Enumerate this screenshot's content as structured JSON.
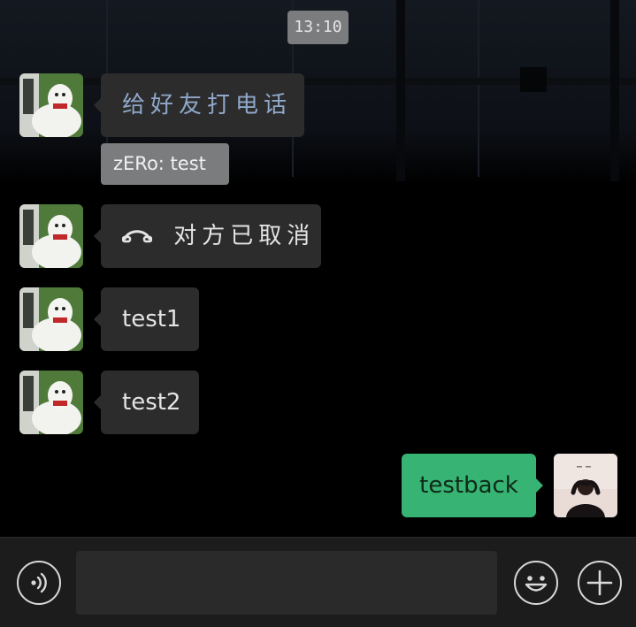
{
  "timestamp": "13:10",
  "messages": [
    {
      "text": "给好友打电话",
      "sender_label": "zERo: test"
    },
    {
      "text": "对方已取消",
      "icon": "hangup-icon"
    },
    {
      "text": "test1"
    },
    {
      "text": "test2"
    },
    {
      "text": "testback"
    }
  ],
  "input": {
    "value": "",
    "placeholder": ""
  },
  "icons": {
    "voice": "voice-icon",
    "emoji": "emoji-icon",
    "more": "plus-icon"
  },
  "colors": {
    "incoming_bubble": "#2c2c2c",
    "outgoing_bubble": "#37b373",
    "system_chip": "#7a7c7e",
    "call_text": "#8fa8c9"
  }
}
